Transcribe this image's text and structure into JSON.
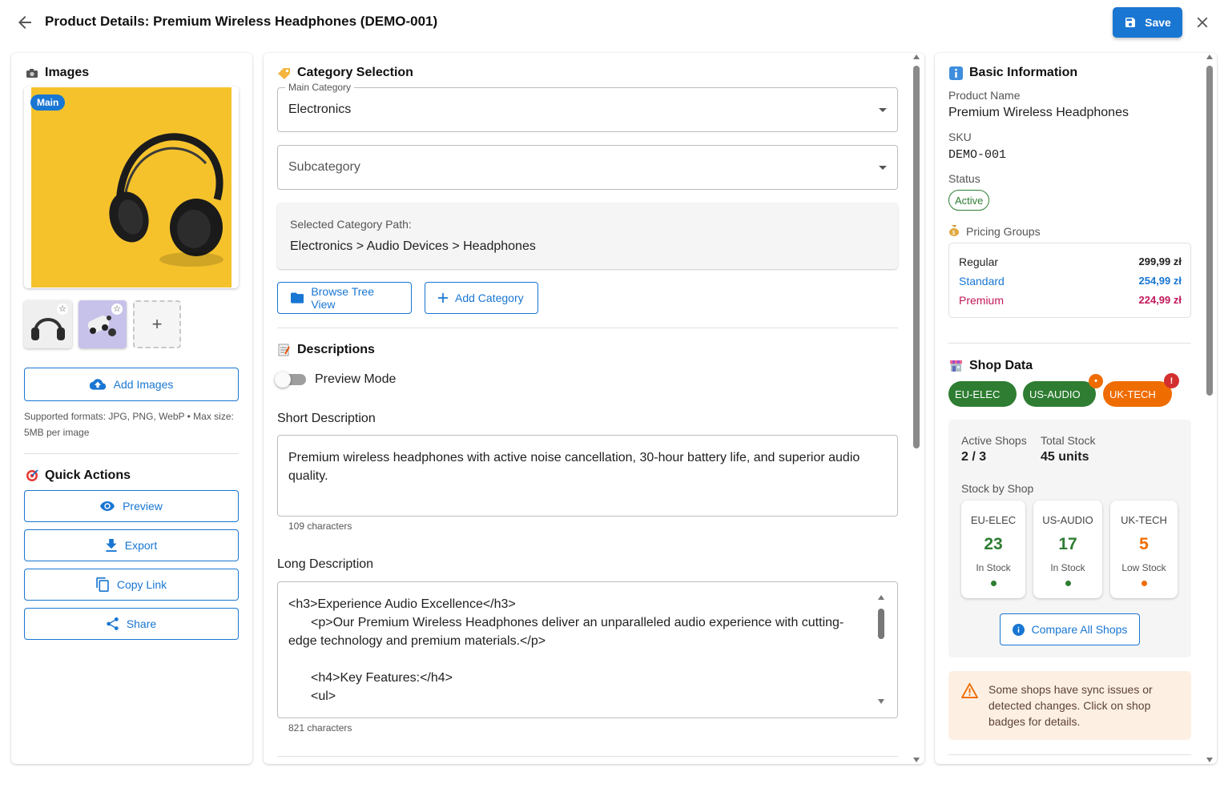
{
  "header": {
    "title": "Product Details: Premium Wireless Headphones (DEMO-001)",
    "save_label": "Save",
    "back_icon": "arrow-left-icon",
    "close_icon": "close-icon"
  },
  "images": {
    "title": "Images",
    "main_badge": "Main",
    "add_images_label": "Add Images",
    "formats_text": "Supported formats: JPG, PNG, WebP • Max size: 5MB per image",
    "thumbnails": [
      "headphones-thumb",
      "earbuds-thumb"
    ]
  },
  "quick_actions": {
    "title": "Quick Actions",
    "items": [
      {
        "label": "Preview",
        "icon": "eye-icon"
      },
      {
        "label": "Export",
        "icon": "download-icon"
      },
      {
        "label": "Copy Link",
        "icon": "copy-icon"
      },
      {
        "label": "Share",
        "icon": "share-icon"
      }
    ]
  },
  "category": {
    "title": "Category Selection",
    "main_label": "Main Category",
    "main_value": "Electronics",
    "sub_placeholder": "Subcategory",
    "path_label": "Selected Category Path:",
    "path_value": "Electronics > Audio Devices > Headphones",
    "browse_label": "Browse Tree View",
    "add_label": "Add Category"
  },
  "descriptions": {
    "title": "Descriptions",
    "preview_mode_label": "Preview Mode",
    "preview_mode_on": false,
    "short_label": "Short Description",
    "short_value": "Premium wireless headphones with active noise cancellation, 30-hour battery life, and superior audio quality.",
    "short_count": "109 characters",
    "long_label": "Long Description",
    "long_lines": [
      "<h3>Experience Audio Excellence</h3>",
      "<p>Our Premium Wireless Headphones deliver an unparalleled audio experience with cutting-edge technology and premium materials.</p>",
      "",
      "<h4>Key Features:</h4>",
      "<ul>"
    ],
    "long_count": "821 characters"
  },
  "basic_info": {
    "title": "Basic Information",
    "product_name_label": "Product Name",
    "product_name": "Premium Wireless Headphones",
    "sku_label": "SKU",
    "sku": "DEMO-001",
    "status_label": "Status",
    "status": "Active",
    "pricing_label": "Pricing Groups",
    "prices": [
      {
        "name": "Regular",
        "value": "299,99 zł",
        "color": "#1f1f1f"
      },
      {
        "name": "Standard",
        "value": "254,99 zł",
        "color": "#1976d2"
      },
      {
        "name": "Premium",
        "value": "224,99 zł",
        "color": "#c2185b"
      }
    ]
  },
  "shop_data": {
    "title": "Shop Data",
    "chips": [
      {
        "name": "EU-ELEC",
        "color": "#2e7d32",
        "badge": ""
      },
      {
        "name": "US-AUDIO",
        "color": "#2e7d32",
        "badge": "•"
      },
      {
        "name": "UK-TECH",
        "color": "#ef6c00",
        "badge": "!"
      }
    ],
    "active_shops_label": "Active Shops",
    "active_shops": "2 / 3",
    "total_stock_label": "Total Stock",
    "total_stock": "45 units",
    "stock_by_shop_label": "Stock by Shop",
    "stock": [
      {
        "shop": "EU-ELEC",
        "qty": "23",
        "status": "In Stock",
        "color": "#2e7d32"
      },
      {
        "shop": "US-AUDIO",
        "qty": "17",
        "status": "In Stock",
        "color": "#2e7d32"
      },
      {
        "shop": "UK-TECH",
        "qty": "5",
        "status": "Low Stock",
        "color": "#ef6c00"
      }
    ],
    "compare_label": "Compare All Shops",
    "warning": "Some shops have sync issues or detected changes. Click on shop badges for details."
  },
  "colors": {
    "primary": "#1976d2",
    "success": "#2e7d32",
    "warning": "#ef6c00",
    "error": "#d32f2f"
  }
}
